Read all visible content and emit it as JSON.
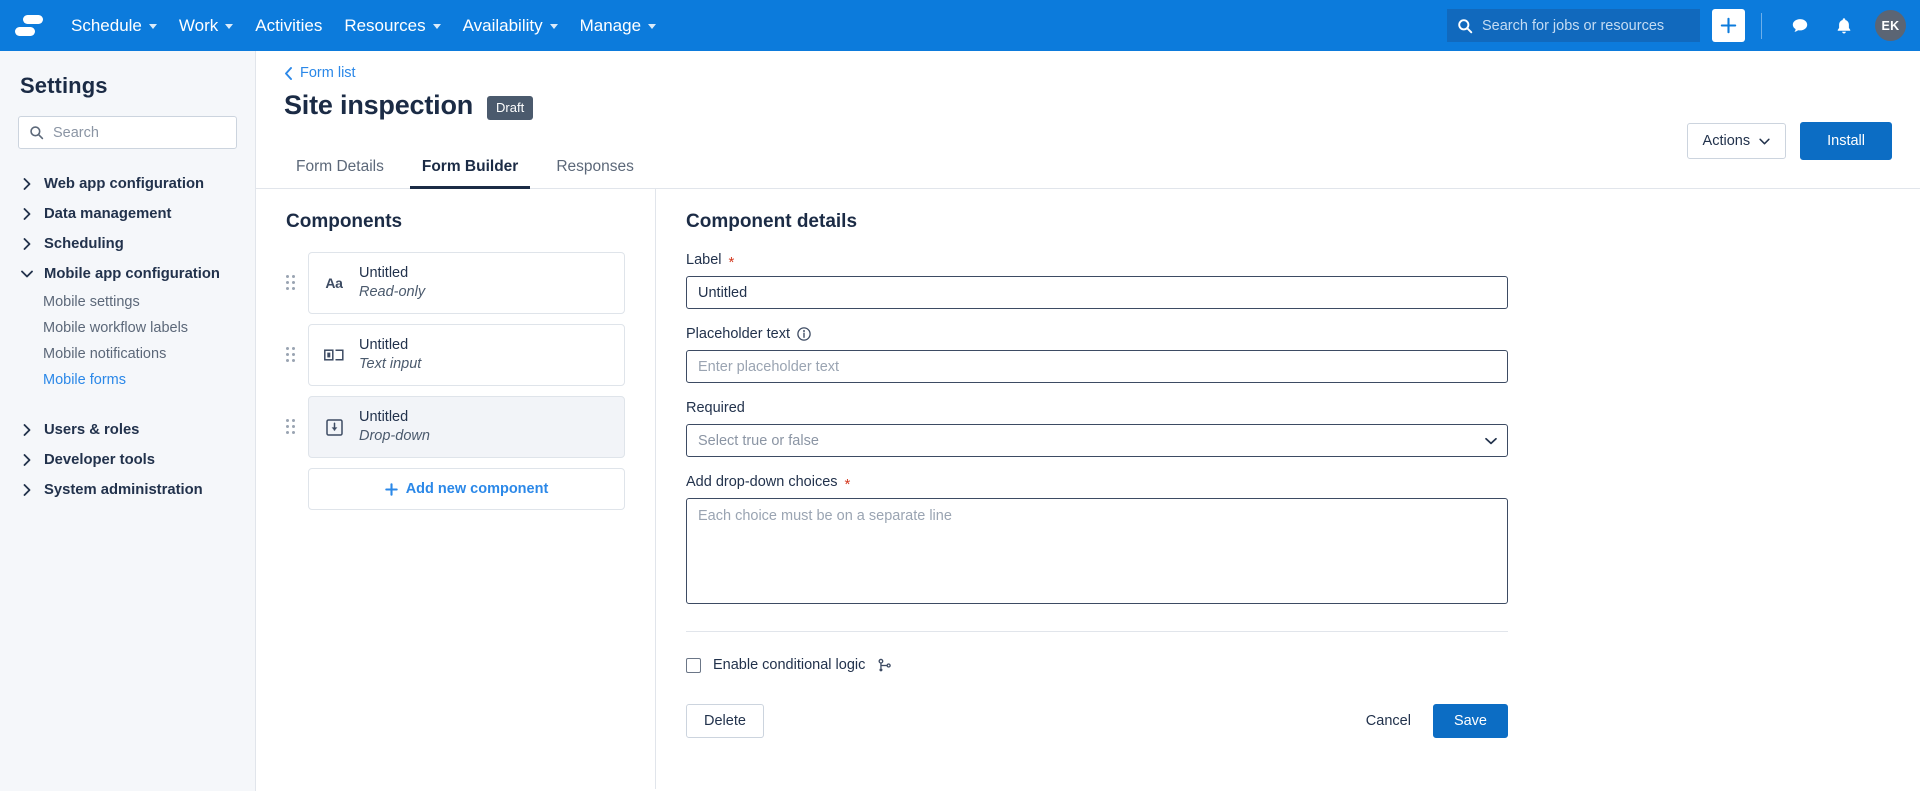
{
  "topnav": {
    "logo_name": "sitebox-logo",
    "brand_color": "#0c7bdc",
    "items": [
      {
        "label": "Schedule",
        "has_caret": true
      },
      {
        "label": "Work",
        "has_caret": true
      },
      {
        "label": "Activities",
        "has_caret": false
      },
      {
        "label": "Resources",
        "has_caret": true
      },
      {
        "label": "Availability",
        "has_caret": true
      },
      {
        "label": "Manage",
        "has_caret": true
      }
    ],
    "search": {
      "placeholder": "Search for jobs or resources",
      "value": ""
    },
    "add_button": "+",
    "avatar_initials": "EK"
  },
  "sidebar": {
    "title": "Settings",
    "search": {
      "placeholder": "Search",
      "value": ""
    },
    "groups": [
      {
        "label": "Web app configuration",
        "expanded": false
      },
      {
        "label": "Data management",
        "expanded": false
      },
      {
        "label": "Scheduling",
        "expanded": false
      },
      {
        "label": "Mobile app configuration",
        "expanded": true
      }
    ],
    "mobile_items": [
      {
        "label": "Mobile settings",
        "active": false
      },
      {
        "label": "Mobile workflow labels",
        "active": false
      },
      {
        "label": "Mobile notifications",
        "active": false
      },
      {
        "label": "Mobile forms",
        "active": true
      }
    ],
    "groups_lower": [
      {
        "label": "Users & roles",
        "expanded": false
      },
      {
        "label": "Developer tools",
        "expanded": false
      },
      {
        "label": "System administration",
        "expanded": false
      }
    ],
    "active_color": "#2b88e8"
  },
  "page": {
    "breadcrumb": "Form list",
    "title": "Site inspection",
    "status_badge": "Draft",
    "actions_button": "Actions",
    "install_button": "Install",
    "tabs": [
      {
        "label": "Form Details",
        "active": false
      },
      {
        "label": "Form Builder",
        "active": true
      },
      {
        "label": "Responses",
        "active": false
      }
    ]
  },
  "components_pane": {
    "title": "Components",
    "items": [
      {
        "name": "Untitled",
        "type": "Read-only",
        "icon": "text-aa-icon",
        "selected": false
      },
      {
        "name": "Untitled",
        "type": "Text input",
        "icon": "text-input-icon",
        "selected": false
      },
      {
        "name": "Untitled",
        "type": "Drop-down",
        "icon": "dropdown-icon",
        "selected": true
      }
    ],
    "add_label": "Add new component"
  },
  "details_pane": {
    "title": "Component details",
    "label_field": {
      "label": "Label",
      "required": true,
      "value": "Untitled",
      "placeholder": ""
    },
    "placeholder_field": {
      "label": "Placeholder text",
      "required": false,
      "has_info_icon": true,
      "value": "",
      "placeholder": "Enter placeholder text"
    },
    "required_field": {
      "label": "Required",
      "required": false,
      "selected": "Select true or false",
      "options": [
        "Select true or false",
        "true",
        "false"
      ]
    },
    "choices_field": {
      "label": "Add drop-down choices",
      "required": true,
      "value": "",
      "placeholder": "Each choice must be on a separate line"
    },
    "conditional": {
      "label": "Enable conditional logic",
      "checked": false,
      "icon": "branch-logic-icon"
    },
    "delete_button": "Delete",
    "cancel_button": "Cancel",
    "save_button": "Save"
  }
}
